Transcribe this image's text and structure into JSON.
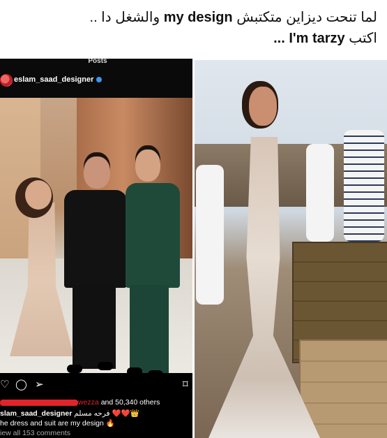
{
  "caption": {
    "line1_prefix": "لما تنحت ديزاين متكتبش",
    "line1_english": "my design",
    "line1_suffix": "والشغل دا ..",
    "line2_prefix": "اكتب",
    "line2_english": "I'm tarzy",
    "line2_suffix": "..."
  },
  "instagram": {
    "tab_label": "Posts",
    "username": "eslam_saad_designer",
    "likes_hidden_name": "wezza",
    "likes_text": "and 50,340 others",
    "caption_username": "slam_saad_designer",
    "caption_text": "فرحه مسلم",
    "caption_emojis": "❤️❤️👑",
    "caption_line2": "he dress and suit are my design",
    "caption_line2_emoji": "🔥",
    "view_comments": "iew all 153 comments",
    "icons": {
      "like": "heart-icon",
      "comment": "comment-icon",
      "share": "share-icon",
      "save": "bookmark-icon"
    }
  },
  "colors": {
    "verified": "#3897f0",
    "scribble": "#e0242b"
  }
}
